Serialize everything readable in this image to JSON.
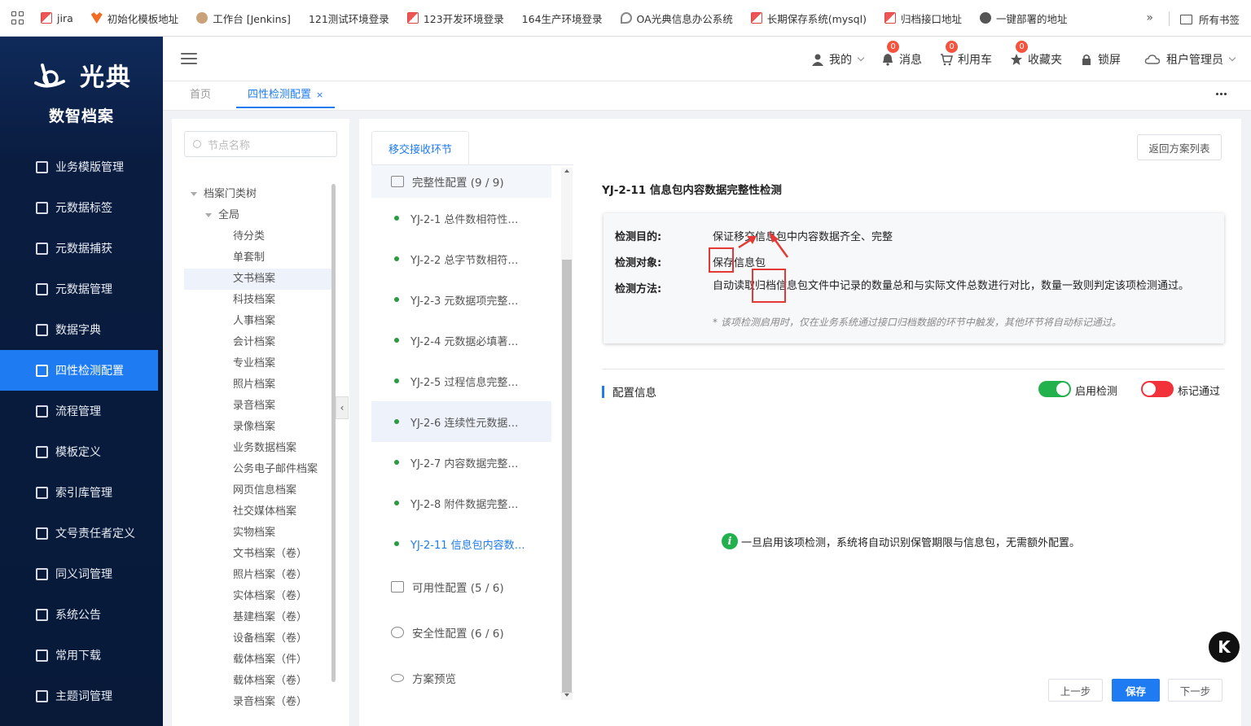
{
  "bookmarks": {
    "items": [
      {
        "label": "jira",
        "icon": "j"
      },
      {
        "label": "初始化模板地址",
        "icon": "fox"
      },
      {
        "label": "工作台 [Jenkins]",
        "icon": "jk"
      },
      {
        "label": "121测试环境登录",
        "icon": ""
      },
      {
        "label": "123开发环境登录",
        "icon": "j"
      },
      {
        "label": "164生产环境登录",
        "icon": ""
      },
      {
        "label": "OA光典信息办公系统",
        "icon": "oa"
      },
      {
        "label": "长期保存系统(mysql)",
        "icon": "j"
      },
      {
        "label": "归档接口地址",
        "icon": "j"
      },
      {
        "label": "一键部署的地址",
        "icon": "gl"
      }
    ],
    "more": "»",
    "folder_label": "所有书签"
  },
  "brand": {
    "name": "光典",
    "subtitle": "数智档案"
  },
  "sidebar": {
    "items": [
      {
        "label": "业务模版管理"
      },
      {
        "label": "元数据标签"
      },
      {
        "label": "元数据捕获"
      },
      {
        "label": "元数据管理"
      },
      {
        "label": "数据字典"
      },
      {
        "label": "四性检测配置",
        "active": true
      },
      {
        "label": "流程管理"
      },
      {
        "label": "模板定义"
      },
      {
        "label": "索引库管理"
      },
      {
        "label": "文号责任者定义"
      },
      {
        "label": "同义词管理"
      },
      {
        "label": "系统公告"
      },
      {
        "label": "常用下载"
      },
      {
        "label": "主题词管理"
      }
    ]
  },
  "header": {
    "mine": "我的",
    "messages": "消息",
    "messages_count": "0",
    "cart": "利用车",
    "cart_count": "0",
    "favorites": "收藏夹",
    "favorites_count": "0",
    "lock": "锁屏",
    "tenant": "租户管理员"
  },
  "tabs": {
    "home": "首页",
    "current": "四性检测配置",
    "close": "×"
  },
  "tree": {
    "search_placeholder": "节点名称",
    "root": "档案门类树",
    "group": "全局",
    "nodes": [
      "待分类",
      "单套制",
      "文书档案",
      "科技档案",
      "人事档案",
      "会计档案",
      "专业档案",
      "照片档案",
      "录音档案",
      "录像档案",
      "业务数据档案",
      "公务电子邮件档案",
      "网页信息档案",
      "社交媒体档案",
      "实物档案",
      "文书档案（卷）",
      "照片档案（卷）",
      "实体档案（卷）",
      "基建档案（卷）",
      "设备档案（卷）",
      "载体档案（件）",
      "载体档案（卷）",
      "录音档案（卷）"
    ],
    "selected": "文书档案"
  },
  "main": {
    "stage_tab": "移交接收环节",
    "back_button": "返回方案列表",
    "groups": {
      "integrity": "完整性配置 (9 / 9)",
      "usability": "可用性配置 (5 / 6)",
      "security": "安全性配置 (6 / 6)",
      "preview": "方案预览"
    },
    "steps": [
      "YJ-2-1 总件数相符性…",
      "YJ-2-2 总字节数相符…",
      "YJ-2-3 元数据项完整…",
      "YJ-2-4 元数据必填著…",
      "YJ-2-5 过程信息完整…",
      "YJ-2-6 连续性元数据…",
      "YJ-2-7 内容数据完整…",
      "YJ-2-8 附件数据完整…",
      "YJ-2-11 信息包内容数…"
    ],
    "detail": {
      "title": "YJ-2-11 信息包内容数据完整性检测",
      "purpose_label": "检测目的:",
      "purpose": "保证移交信息包中内容数据齐全、完整",
      "object_label": "检测对象:",
      "object": "保存信息包",
      "method_label": "检测方法:",
      "method": "自动读取归档信息包文件中记录的数量总和与实际文件总数进行对比，数量一致则判定该项检测通过。",
      "note": "* 该项检测启用时，仅在业务系统通过接口归档数据的环节中触发，其他环节将自动标记通过。"
    },
    "config": {
      "title": "配置信息",
      "enable_label": "启用检测",
      "mark_label": "标记通过",
      "hint_icon": "i",
      "hint": "一旦启用该项检测，系统将自动识别保管期限与信息包，无需额外配置。"
    },
    "buttons": {
      "prev": "上一步",
      "save": "保存",
      "next": "下一步"
    }
  },
  "floating": {
    "label": "K"
  }
}
